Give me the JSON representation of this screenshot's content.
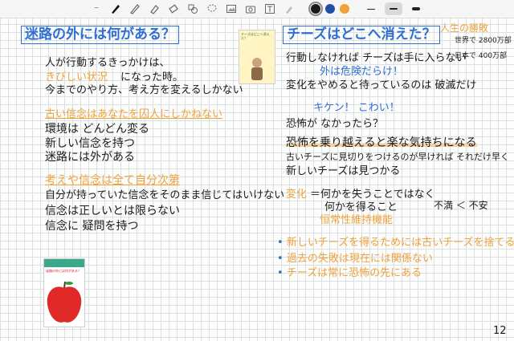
{
  "toolbar": {
    "tools": [
      "dash-icon",
      "pen-icon",
      "pencil-icon",
      "highlighter-icon",
      "eraser-icon",
      "shapes-icon",
      "lasso-icon",
      "image-icon",
      "camera-icon",
      "text-icon",
      "brush-icon"
    ],
    "colors": {
      "black": "#1a1a1a",
      "blue": "#1f4fa8",
      "orange": "#f0a23a"
    },
    "selected_color": "black",
    "selected_thickness": "medium"
  },
  "left": {
    "title": "迷路の外には何がある？",
    "lines": [
      "人が行動するきっかけは、",
      "きびしい状況",
      "になった時。",
      "今までのやり方、考え方を変えるしかない",
      "古い信念はあなたを囚人にしかねない",
      "環境は どんどん変る",
      "新しい信念を持つ",
      "迷路には外がある",
      "考えや信念は全て自分次第",
      "自分が持っていた信念をそのまま信じてはいけない",
      "信念は正しいとは限らない",
      "信念に 疑問を持つ"
    ]
  },
  "right": {
    "title": "チーズはどこへ消えた？",
    "side": [
      "人生の勝敗",
      "世界で 2800万部",
      "日本で 400万部"
    ],
    "lines": [
      "行動しなければ チーズは手に入らない",
      "外は危険だらけ！",
      "変化をやめると待っているのは 破滅だけ",
      "キケン！ こわい！",
      "恐怖が なかったら？",
      "恐怖を乗り越えると楽な気持ちになる",
      "古いチーズに見切りをつけるのが早ければ それだけ早く",
      "新しいチーズは見つかる",
      "変化",
      "＝何かを失うことではなく",
      "何かを得ること",
      "不満 ＜ 不安",
      "恒常性維持機能"
    ],
    "bullets": [
      "新しいチーズを得るためには古いチーズを捨てる",
      "過去の失敗は現在には関係ない",
      "チーズは常に恐怖の先にある"
    ]
  },
  "books": {
    "cheese_cover_title": "チーズはどこへ消えた？",
    "maze_cover_title": "迷路の外には何がある？"
  },
  "page_number": "12"
}
